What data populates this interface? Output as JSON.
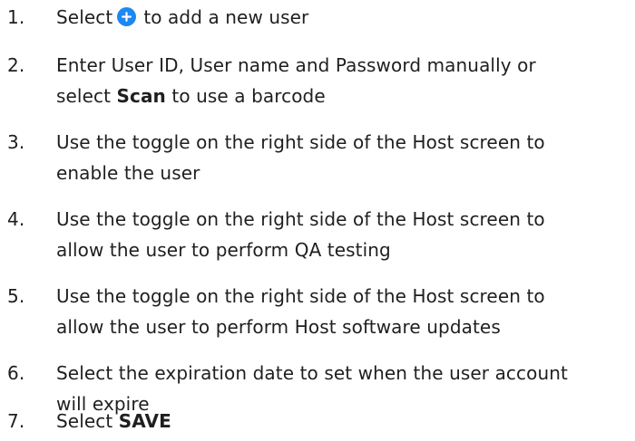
{
  "steps": [
    {
      "number": "1.",
      "before_icon": "Select",
      "icon": "plus-circle-icon",
      "after_icon": "to add a new user"
    },
    {
      "number": "2.",
      "line1": "Enter User ID, User name and Password manually or",
      "line2_prefix": "select",
      "line2_bold": "Scan",
      "line2_suffix": "to use a barcode"
    },
    {
      "number": "3.",
      "line1": "Use the toggle on the right side of the Host screen to",
      "line2": "enable the user"
    },
    {
      "number": "4.",
      "line1": "Use the toggle on the right side of the Host screen to",
      "line2": "allow the user to perform QA testing"
    },
    {
      "number": "5.",
      "line1": "Use the toggle on the right side of the Host screen to",
      "line2": "allow the user to perform Host software updates"
    },
    {
      "number": "6.",
      "line1": "Select the expiration date to set when the user account",
      "line2": "will expire"
    },
    {
      "number": "7.",
      "prefix": "Select",
      "bold": "SAVE"
    }
  ],
  "colors": {
    "icon_blue": "#1e88f0",
    "text": "#1f1f1f"
  }
}
